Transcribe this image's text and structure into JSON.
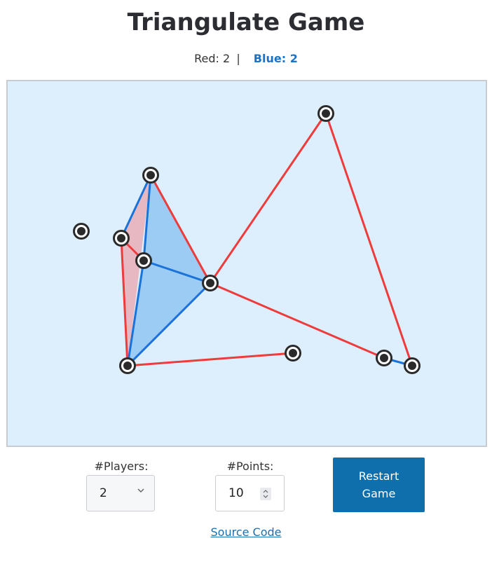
{
  "title": "Triangulate Game",
  "score": {
    "red": "Red: 2",
    "separator": "|",
    "blue": "Blue: 2"
  },
  "colors": {
    "red_edge": "#ee3b3b",
    "blue_edge": "#1a73d9",
    "red_fill": "#e8b8c2",
    "blue_fill": "#9ccbf3",
    "board_bg": "#ddeefc",
    "point": "#2a2a2a",
    "button_bg": "#0f6fad",
    "link": "#1a6fb0"
  },
  "controls": {
    "players_label": "#Players:",
    "players_value": "2",
    "points_label": "#Points:",
    "points_value": "10",
    "restart_label": "Restart Game"
  },
  "footer": {
    "source_link": "Source Code"
  }
}
